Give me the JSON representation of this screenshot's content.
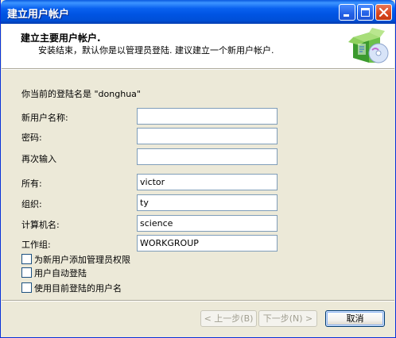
{
  "window": {
    "title": "建立用户帐户"
  },
  "header": {
    "title": "建立主要用户帐户.",
    "subtitle": "安装结束，默认你是以管理员登陆.  建议建立一个新用户帐户."
  },
  "main": {
    "current_login_text": "你当前的登陆名是 \"donghua\"",
    "fields": [
      {
        "label": "新用户名称:",
        "value": ""
      },
      {
        "label": "密码:",
        "value": ""
      },
      {
        "label": "再次输入",
        "value": ""
      },
      {
        "label": "所有:",
        "value": "victor"
      },
      {
        "label": "组织:",
        "value": "ty"
      },
      {
        "label": "计算机名:",
        "value": "science"
      },
      {
        "label": "工作组:",
        "value": "WORKGROUP"
      }
    ],
    "checkboxes": [
      {
        "label": "为新用户添加管理员权限",
        "checked": false
      },
      {
        "label": "用户自动登陆",
        "checked": false
      },
      {
        "label": "使用目前登陆的用户名",
        "checked": false
      }
    ]
  },
  "buttons": {
    "back": "< 上一步(B)",
    "next": "下一步(N) >",
    "cancel": "取消"
  }
}
